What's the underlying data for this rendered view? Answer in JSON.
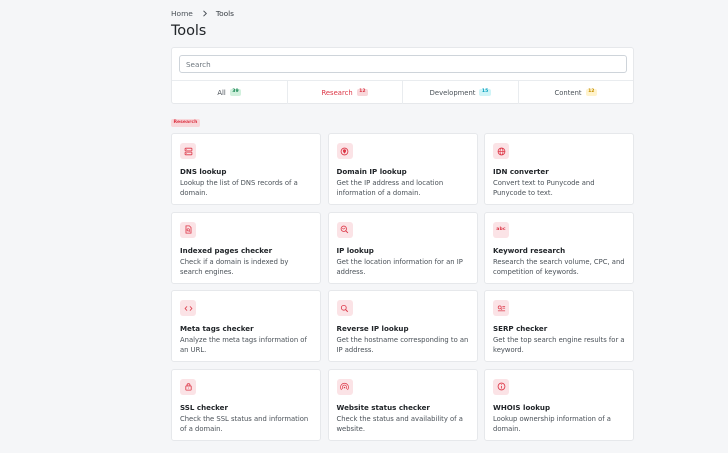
{
  "breadcrumb": {
    "home": "Home",
    "current": "Tools"
  },
  "page_title": "Tools",
  "search": {
    "placeholder": "Search",
    "value": ""
  },
  "tabs": [
    {
      "label": "All",
      "count": "39",
      "color": "green",
      "active": false
    },
    {
      "label": "Research",
      "count": "12",
      "color": "red",
      "active": true
    },
    {
      "label": "Development",
      "count": "15",
      "color": "teal",
      "active": false
    },
    {
      "label": "Content",
      "count": "12",
      "color": "yellow",
      "active": false
    }
  ],
  "section_label": "Research",
  "tools": [
    {
      "title": "DNS lookup",
      "desc": "Lookup the list of DNS records of a domain.",
      "icon": "server-icon"
    },
    {
      "title": "Domain IP lookup",
      "desc": "Get the IP address and location information of a domain.",
      "icon": "location-pin-icon"
    },
    {
      "title": "IDN converter",
      "desc": "Convert text to Punycode and Punycode to text.",
      "icon": "globe-icon"
    },
    {
      "title": "Indexed pages checker",
      "desc": "Check if a domain is indexed by search engines.",
      "icon": "file-search-icon"
    },
    {
      "title": "IP lookup",
      "desc": "Get the location information for an IP address.",
      "icon": "map-search-icon"
    },
    {
      "title": "Keyword research",
      "desc": "Research the search volume, CPC, and competition of keywords.",
      "icon": "abc-icon",
      "icon_text": "abc"
    },
    {
      "title": "Meta tags checker",
      "desc": "Analyze the meta tags information of an URL.",
      "icon": "code-icon"
    },
    {
      "title": "Reverse IP lookup",
      "desc": "Get the hostname corresponding to an IP address.",
      "icon": "search-icon"
    },
    {
      "title": "SERP checker",
      "desc": "Get the top search engine results for a keyword.",
      "icon": "search-list-icon"
    },
    {
      "title": "SSL checker",
      "desc": "Check the SSL status and information of a domain.",
      "icon": "lock-icon"
    },
    {
      "title": "Website status checker",
      "desc": "Check the status and availability of a website.",
      "icon": "signal-icon"
    },
    {
      "title": "WHOIS lookup",
      "desc": "Lookup ownership information of a domain.",
      "icon": "info-icon"
    }
  ],
  "colors": {
    "accent": "#dc3545",
    "accent_bg": "#fbe3e6",
    "background": "#f5f6f8"
  }
}
